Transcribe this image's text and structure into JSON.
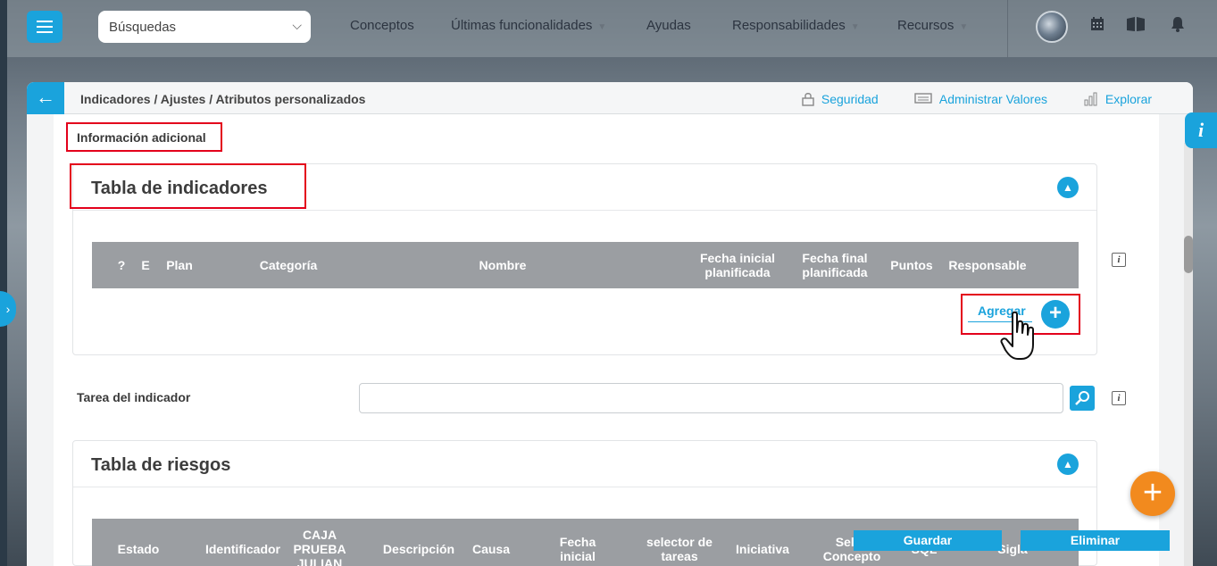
{
  "topbar": {
    "search_label": "Búsquedas",
    "nav": [
      {
        "label": "Conceptos"
      },
      {
        "label": "Últimas funcionalidades"
      },
      {
        "label": "Ayudas"
      },
      {
        "label": "Responsabilidades"
      },
      {
        "label": "Recursos"
      }
    ]
  },
  "header": {
    "breadcrumb": "Indicadores / Ajustes / Atributos personalizados",
    "actions": [
      {
        "label": "Seguridad",
        "icon": "lock-icon"
      },
      {
        "label": "Administrar Valores",
        "icon": "keyboard-icon"
      },
      {
        "label": "Explorar",
        "icon": "bar-chart-icon"
      }
    ]
  },
  "main": {
    "section_label": "Información adicional",
    "indicators_table": {
      "title": "Tabla de indicadores",
      "columns": [
        "?",
        "E",
        "Plan",
        "Categoría",
        "Nombre",
        "Fecha inicial planificada",
        "Fecha final planificada",
        "Puntos",
        "Responsable"
      ],
      "add_label": "Agregar"
    },
    "task_field": {
      "label": "Tarea del indicador",
      "value": ""
    },
    "risks_table": {
      "title": "Tabla de riesgos",
      "columns": [
        "Estado",
        "Identificador",
        "CAJA PRUEBA JULIAN",
        "Descripción",
        "Causa",
        "Fecha inicial",
        "selector de tareas",
        "Iniciativa",
        "Selec Concepto",
        "SQL",
        "Sigla"
      ]
    }
  },
  "footer": {
    "save_label": "Guardar",
    "delete_label": "Eliminar"
  },
  "colors": {
    "accent": "#1aa3dc",
    "highlight": "#e3001b",
    "fab": "#f28a1e",
    "table_header": "#9b9ea2"
  }
}
